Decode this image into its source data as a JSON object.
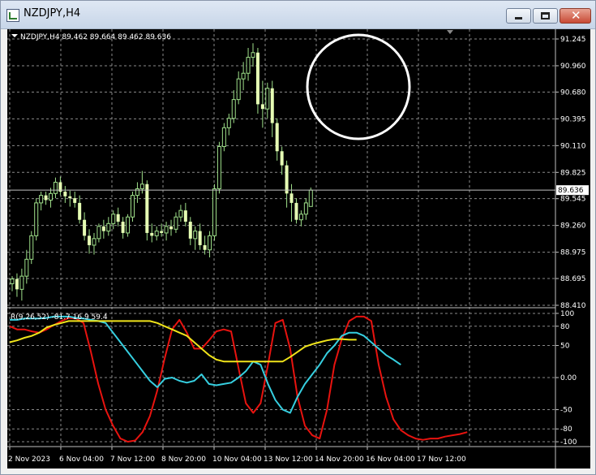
{
  "window": {
    "title": "NZDJPY,H4",
    "controls": {
      "minimize": "minimize",
      "maximize": "maximize",
      "close": "close"
    }
  },
  "colors": {
    "background": "#000000",
    "grid": "#8a8a8a",
    "candle": "#e6ffb4",
    "wick": "#9fe08a",
    "price_line": "#c0c0c0",
    "highlight_circle": "#ffffff",
    "red_line": "#e8130f",
    "cyan_line": "#36cfe0",
    "yellow_line": "#f0e41a"
  },
  "main_panel": {
    "header": "NZDJPY,H4  89.462 89.664 89.462 89.636",
    "current_price": "89.636",
    "y_labels": [
      "91.245",
      "90.960",
      "90.680",
      "90.395",
      "90.110",
      "89.825",
      "89.545",
      "89.260",
      "88.975",
      "88.695",
      "88.410"
    ]
  },
  "indicator_panel": {
    "header": "R(9,26,52) -81.7 16.9 59.4",
    "y_labels": [
      "100",
      "80",
      "50",
      "0.00",
      "-50",
      "-80",
      "-100"
    ]
  },
  "x_labels": [
    "2 Nov 2023",
    "6 Nov 04:00",
    "7 Nov 12:00",
    "8 Nov 20:00",
    "10 Nov 04:00",
    "13 Nov 12:00",
    "14 Nov 20:00",
    "16 Nov 04:00",
    "17 Nov 12:00"
  ],
  "chart_data": {
    "type": "candlestick",
    "symbol": "NZDJPY",
    "timeframe": "H4",
    "price_ylim": [
      88.41,
      91.245
    ],
    "candles": [
      {
        "o": 88.64,
        "h": 88.72,
        "l": 88.56,
        "c": 88.69
      },
      {
        "o": 88.69,
        "h": 88.75,
        "l": 88.5,
        "c": 88.58
      },
      {
        "o": 88.58,
        "h": 88.8,
        "l": 88.46,
        "c": 88.72
      },
      {
        "o": 88.72,
        "h": 89.0,
        "l": 88.64,
        "c": 88.9
      },
      {
        "o": 88.9,
        "h": 89.2,
        "l": 88.85,
        "c": 89.15
      },
      {
        "o": 89.15,
        "h": 89.55,
        "l": 89.1,
        "c": 89.5
      },
      {
        "o": 89.5,
        "h": 89.62,
        "l": 89.42,
        "c": 89.58
      },
      {
        "o": 89.58,
        "h": 89.62,
        "l": 89.48,
        "c": 89.53
      },
      {
        "o": 89.53,
        "h": 89.66,
        "l": 89.45,
        "c": 89.6
      },
      {
        "o": 89.6,
        "h": 89.77,
        "l": 89.55,
        "c": 89.72
      },
      {
        "o": 89.72,
        "h": 89.78,
        "l": 89.58,
        "c": 89.62
      },
      {
        "o": 89.62,
        "h": 89.68,
        "l": 89.5,
        "c": 89.57
      },
      {
        "o": 89.57,
        "h": 89.63,
        "l": 89.46,
        "c": 89.55
      },
      {
        "o": 89.55,
        "h": 89.62,
        "l": 89.45,
        "c": 89.5
      },
      {
        "o": 89.5,
        "h": 89.58,
        "l": 89.28,
        "c": 89.32
      },
      {
        "o": 89.32,
        "h": 89.4,
        "l": 89.1,
        "c": 89.15
      },
      {
        "o": 89.15,
        "h": 89.22,
        "l": 88.96,
        "c": 89.05
      },
      {
        "o": 89.05,
        "h": 89.18,
        "l": 88.95,
        "c": 89.12
      },
      {
        "o": 89.12,
        "h": 89.28,
        "l": 89.08,
        "c": 89.25
      },
      {
        "o": 89.25,
        "h": 89.32,
        "l": 89.12,
        "c": 89.2
      },
      {
        "o": 89.2,
        "h": 89.35,
        "l": 89.15,
        "c": 89.28
      },
      {
        "o": 89.28,
        "h": 89.42,
        "l": 89.22,
        "c": 89.38
      },
      {
        "o": 89.38,
        "h": 89.45,
        "l": 89.25,
        "c": 89.3
      },
      {
        "o": 89.3,
        "h": 89.35,
        "l": 89.12,
        "c": 89.18
      },
      {
        "o": 89.18,
        "h": 89.38,
        "l": 89.14,
        "c": 89.35
      },
      {
        "o": 89.35,
        "h": 89.62,
        "l": 89.3,
        "c": 89.58
      },
      {
        "o": 89.58,
        "h": 89.72,
        "l": 89.5,
        "c": 89.65
      },
      {
        "o": 89.65,
        "h": 89.84,
        "l": 89.6,
        "c": 89.7
      },
      {
        "o": 89.7,
        "h": 89.74,
        "l": 89.1,
        "c": 89.18
      },
      {
        "o": 89.18,
        "h": 89.28,
        "l": 89.08,
        "c": 89.15
      },
      {
        "o": 89.15,
        "h": 89.25,
        "l": 89.1,
        "c": 89.2
      },
      {
        "o": 89.2,
        "h": 89.28,
        "l": 89.14,
        "c": 89.18
      },
      {
        "o": 89.18,
        "h": 89.3,
        "l": 89.1,
        "c": 89.25
      },
      {
        "o": 89.25,
        "h": 89.32,
        "l": 89.15,
        "c": 89.22
      },
      {
        "o": 89.22,
        "h": 89.4,
        "l": 89.18,
        "c": 89.35
      },
      {
        "o": 89.35,
        "h": 89.48,
        "l": 89.3,
        "c": 89.42
      },
      {
        "o": 89.42,
        "h": 89.5,
        "l": 89.25,
        "c": 89.3
      },
      {
        "o": 89.3,
        "h": 89.35,
        "l": 89.05,
        "c": 89.12
      },
      {
        "o": 89.12,
        "h": 89.25,
        "l": 89.0,
        "c": 89.2
      },
      {
        "o": 89.2,
        "h": 89.28,
        "l": 89.0,
        "c": 89.05
      },
      {
        "o": 89.05,
        "h": 89.15,
        "l": 88.95,
        "c": 89.0
      },
      {
        "o": 89.0,
        "h": 89.2,
        "l": 88.92,
        "c": 89.15
      },
      {
        "o": 89.15,
        "h": 89.7,
        "l": 89.1,
        "c": 89.65
      },
      {
        "o": 89.65,
        "h": 90.15,
        "l": 89.6,
        "c": 90.1
      },
      {
        "o": 90.1,
        "h": 90.35,
        "l": 90.05,
        "c": 90.3
      },
      {
        "o": 90.3,
        "h": 90.45,
        "l": 90.22,
        "c": 90.4
      },
      {
        "o": 90.4,
        "h": 90.7,
        "l": 90.35,
        "c": 90.6
      },
      {
        "o": 90.6,
        "h": 90.9,
        "l": 90.55,
        "c": 90.82
      },
      {
        "o": 90.82,
        "h": 91.0,
        "l": 90.7,
        "c": 90.88
      },
      {
        "o": 90.88,
        "h": 91.15,
        "l": 90.8,
        "c": 91.05
      },
      {
        "o": 91.05,
        "h": 91.2,
        "l": 90.95,
        "c": 91.1
      },
      {
        "o": 91.1,
        "h": 91.15,
        "l": 90.45,
        "c": 90.55
      },
      {
        "o": 90.55,
        "h": 90.8,
        "l": 90.3,
        "c": 90.5
      },
      {
        "o": 90.5,
        "h": 90.78,
        "l": 90.4,
        "c": 90.72
      },
      {
        "o": 90.72,
        "h": 90.8,
        "l": 90.2,
        "c": 90.35
      },
      {
        "o": 90.35,
        "h": 90.4,
        "l": 89.95,
        "c": 90.05
      },
      {
        "o": 90.05,
        "h": 90.1,
        "l": 89.8,
        "c": 89.9
      },
      {
        "o": 89.9,
        "h": 89.95,
        "l": 89.45,
        "c": 89.6
      },
      {
        "o": 89.6,
        "h": 89.7,
        "l": 89.3,
        "c": 89.5
      },
      {
        "o": 89.5,
        "h": 89.55,
        "l": 89.28,
        "c": 89.32
      },
      {
        "o": 89.32,
        "h": 89.42,
        "l": 89.25,
        "c": 89.38
      },
      {
        "o": 89.38,
        "h": 89.55,
        "l": 89.32,
        "c": 89.5
      },
      {
        "o": 89.462,
        "h": 89.664,
        "l": 89.462,
        "c": 89.636
      }
    ],
    "indicator": {
      "name": "R(9,26,52)",
      "ylim": [
        -105,
        105
      ],
      "levels": [
        100,
        80,
        50,
        0,
        -50,
        -80,
        -100
      ],
      "series": [
        {
          "name": "R(9)",
          "color": "#e8130f",
          "values": [
            80,
            75,
            75,
            72,
            70,
            75,
            82,
            88,
            93,
            92,
            85,
            40,
            -10,
            -50,
            -75,
            -95,
            -100,
            -98,
            -85,
            -60,
            -20,
            30,
            75,
            90,
            70,
            45,
            45,
            58,
            72,
            75,
            72,
            15,
            -40,
            -55,
            -40,
            20,
            85,
            90,
            45,
            -30,
            -75,
            -90,
            -95,
            -50,
            20,
            60,
            88,
            95,
            95,
            88,
            20,
            -30,
            -65,
            -82,
            -90,
            -95,
            -97,
            -95,
            -95,
            -92,
            -90,
            -88,
            -85
          ]
        },
        {
          "name": "R(26)",
          "color": "#36cfe0",
          "values": [
            90,
            90,
            92,
            92,
            92,
            93,
            95,
            95,
            95,
            93,
            92,
            90,
            88,
            85,
            70,
            55,
            40,
            25,
            10,
            -5,
            -15,
            -2,
            0,
            -5,
            -8,
            -5,
            5,
            -10,
            -12,
            -10,
            -8,
            0,
            10,
            25,
            20,
            -10,
            -35,
            -50,
            -55,
            -30,
            -10,
            5,
            20,
            38,
            50,
            65,
            70,
            70,
            65,
            55,
            45,
            35,
            28,
            20
          ]
        },
        {
          "name": "R(52)",
          "color": "#f0e41a",
          "values": [
            55,
            58,
            62,
            65,
            70,
            78,
            82,
            85,
            88,
            88,
            88,
            88,
            88,
            88,
            88,
            88,
            88,
            88,
            88,
            88,
            85,
            80,
            75,
            70,
            65,
            55,
            45,
            35,
            28,
            25,
            25,
            25,
            25,
            25,
            25,
            25,
            25,
            25,
            32,
            40,
            48,
            52,
            55,
            58,
            60,
            60,
            59,
            59
          ]
        }
      ]
    }
  }
}
